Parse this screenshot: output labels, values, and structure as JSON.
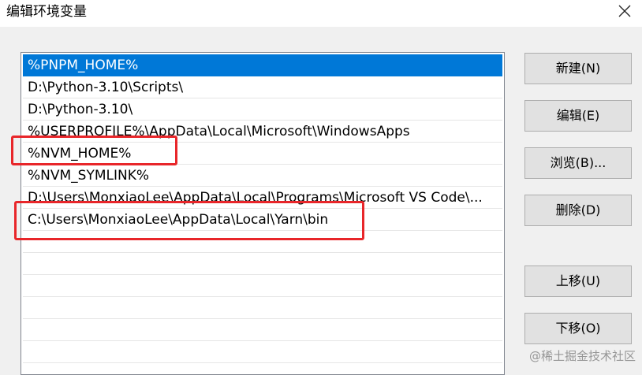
{
  "window": {
    "title": "编辑环境变量",
    "close_icon": "close-icon"
  },
  "path_list": {
    "items": [
      "%PNPM_HOME%",
      "D:\\Python-3.10\\Scripts\\",
      "D:\\Python-3.10\\",
      "%USERPROFILE%\\AppData\\Local\\Microsoft\\WindowsApps",
      "%NVM_HOME%",
      "%NVM_SYMLINK%",
      "D:\\Users\\MonxiaoLee\\AppData\\Local\\Programs\\Microsoft VS Code\\...",
      "C:\\Users\\MonxiaoLee\\AppData\\Local\\Yarn\\bin"
    ],
    "selected_index": 0
  },
  "buttons": {
    "new": "新建(N)",
    "edit": "编辑(E)",
    "browse": "浏览(B)...",
    "delete": "删除(D)",
    "move_up": "上移(U)",
    "move_down": "下移(O)"
  },
  "watermark": "@稀土掘金技术社区",
  "colors": {
    "selection": "#0078d7",
    "highlight_box": "#e8262a"
  }
}
